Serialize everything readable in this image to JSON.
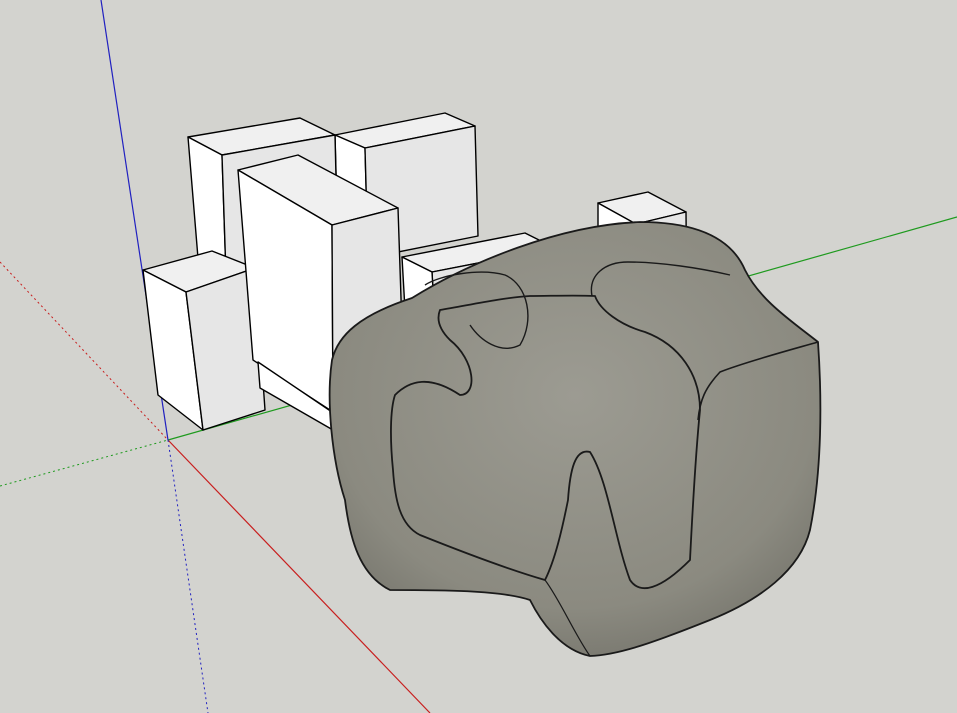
{
  "viewport": {
    "background_color": "#d3d3cf",
    "axis_colors": {
      "red": "#c81e1e",
      "green": "#1e9a1e",
      "blue": "#2020c0"
    },
    "box_fill_colors": {
      "top": "#f0f0f0",
      "left": "#ffffff",
      "right": "#e6e6e6"
    },
    "edge_color": "#000000",
    "organic_form_color": "#8b8a80"
  }
}
